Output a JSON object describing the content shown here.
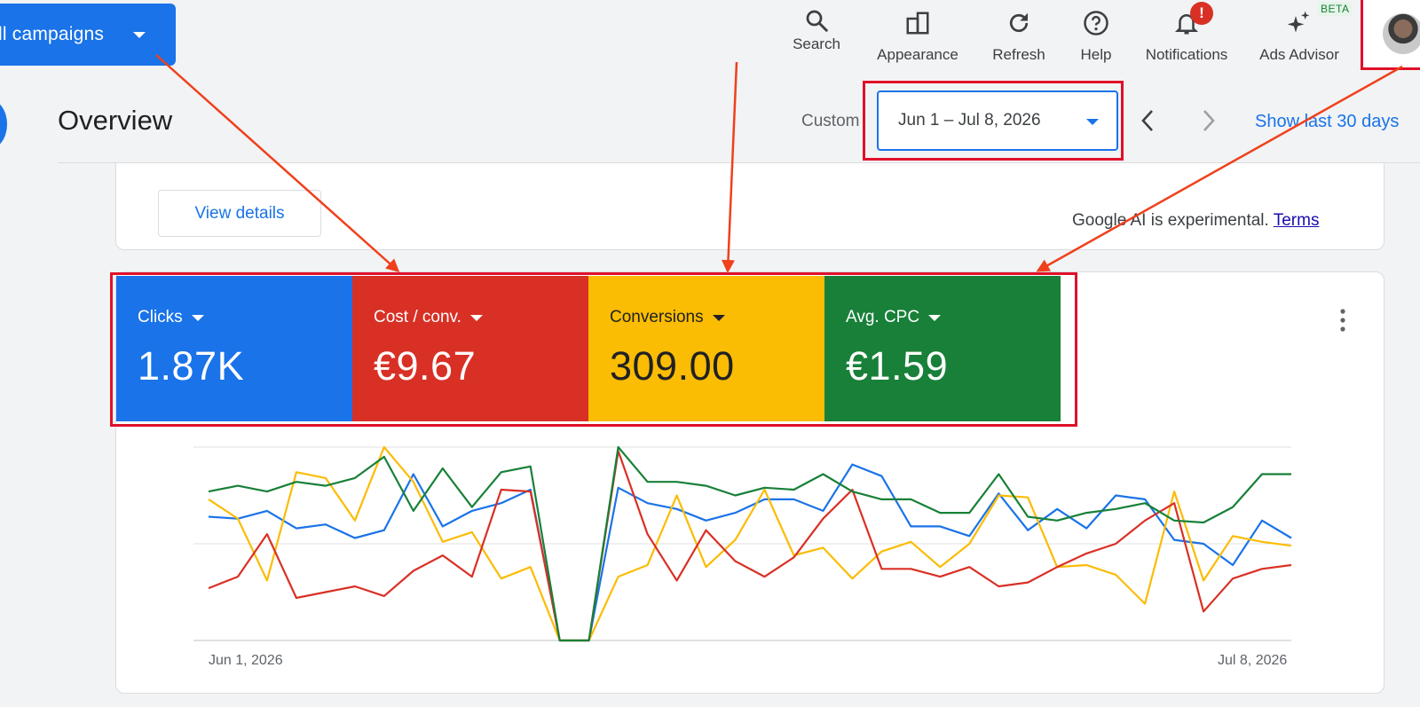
{
  "header": {
    "campaign_selector": "ll campaigns",
    "toolbar": [
      {
        "key": "search",
        "label": "Search",
        "icon": "search-icon"
      },
      {
        "key": "appearance",
        "label": "Appearance",
        "icon": "appearance-icon"
      },
      {
        "key": "refresh",
        "label": "Refresh",
        "icon": "refresh-icon"
      },
      {
        "key": "help",
        "label": "Help",
        "icon": "help-icon"
      },
      {
        "key": "notifications",
        "label": "Notifications",
        "icon": "bell-icon",
        "alert": "!"
      },
      {
        "key": "ads_advisor",
        "label": "Ads Advisor",
        "icon": "sparkle-icon",
        "badge": "BETA"
      }
    ]
  },
  "overview": {
    "title": "Overview",
    "range_label": "Custom",
    "date_range": "Jun 1 – Jul 8, 2026",
    "show_last": "Show last 30 days"
  },
  "summary_card": {
    "view_details": "View details",
    "ai_note": "Google AI is experimental.",
    "terms": "Terms"
  },
  "kpis": [
    {
      "name": "Clicks",
      "value": "1.87K",
      "color": "#1a73e8",
      "text_color": "#ffffff"
    },
    {
      "name": "Cost / conv.",
      "value": "€9.67",
      "color": "#d93025",
      "text_color": "#ffffff"
    },
    {
      "name": "Conversions",
      "value": "309.00",
      "color": "#fbbc04",
      "text_color": "#202124"
    },
    {
      "name": "Avg. CPC",
      "value": "€1.59",
      "color": "#188038",
      "text_color": "#ffffff"
    }
  ],
  "chart_data": {
    "type": "line",
    "x_start_label": "Jun 1, 2026",
    "x_end_label": "Jul 8, 2026",
    "ylim": [
      0,
      1
    ],
    "grid": true,
    "series": [
      {
        "color": "#1a73e8",
        "values": [
          0.64,
          0.63,
          0.67,
          0.58,
          0.6,
          0.53,
          0.57,
          0.86,
          0.59,
          0.67,
          0.71,
          0.78,
          0.0,
          0.0,
          0.79,
          0.71,
          0.68,
          0.62,
          0.66,
          0.73,
          0.73,
          0.67,
          0.91,
          0.85,
          0.59,
          0.59,
          0.54,
          0.76,
          0.57,
          0.68,
          0.58,
          0.75,
          0.73,
          0.52,
          0.5,
          0.39,
          0.62,
          0.53
        ]
      },
      {
        "color": "#fbbc04",
        "values": [
          0.73,
          0.63,
          0.31,
          0.87,
          0.84,
          0.62,
          1.0,
          0.82,
          0.51,
          0.56,
          0.32,
          0.38,
          0.0,
          0.0,
          0.33,
          0.39,
          0.75,
          0.38,
          0.52,
          0.78,
          0.44,
          0.48,
          0.32,
          0.46,
          0.51,
          0.38,
          0.5,
          0.75,
          0.74,
          0.38,
          0.39,
          0.34,
          0.19,
          0.77,
          0.31,
          0.54,
          0.51,
          0.49
        ]
      },
      {
        "color": "#d93025",
        "values": [
          0.27,
          0.33,
          0.55,
          0.22,
          0.25,
          0.28,
          0.23,
          0.36,
          0.44,
          0.33,
          0.78,
          0.77,
          0.0,
          0.0,
          0.98,
          0.55,
          0.31,
          0.57,
          0.41,
          0.33,
          0.43,
          0.63,
          0.78,
          0.37,
          0.37,
          0.33,
          0.38,
          0.28,
          0.3,
          0.38,
          0.45,
          0.5,
          0.62,
          0.71,
          0.15,
          0.32,
          0.37,
          0.39
        ]
      },
      {
        "color": "#188038",
        "values": [
          0.77,
          0.8,
          0.77,
          0.82,
          0.8,
          0.84,
          0.95,
          0.67,
          0.89,
          0.69,
          0.87,
          0.9,
          0.0,
          0.0,
          1.0,
          0.82,
          0.82,
          0.8,
          0.75,
          0.79,
          0.78,
          0.86,
          0.77,
          0.73,
          0.73,
          0.66,
          0.66,
          0.86,
          0.64,
          0.62,
          0.66,
          0.68,
          0.71,
          0.62,
          0.61,
          0.69,
          0.86,
          0.86
        ]
      }
    ]
  }
}
